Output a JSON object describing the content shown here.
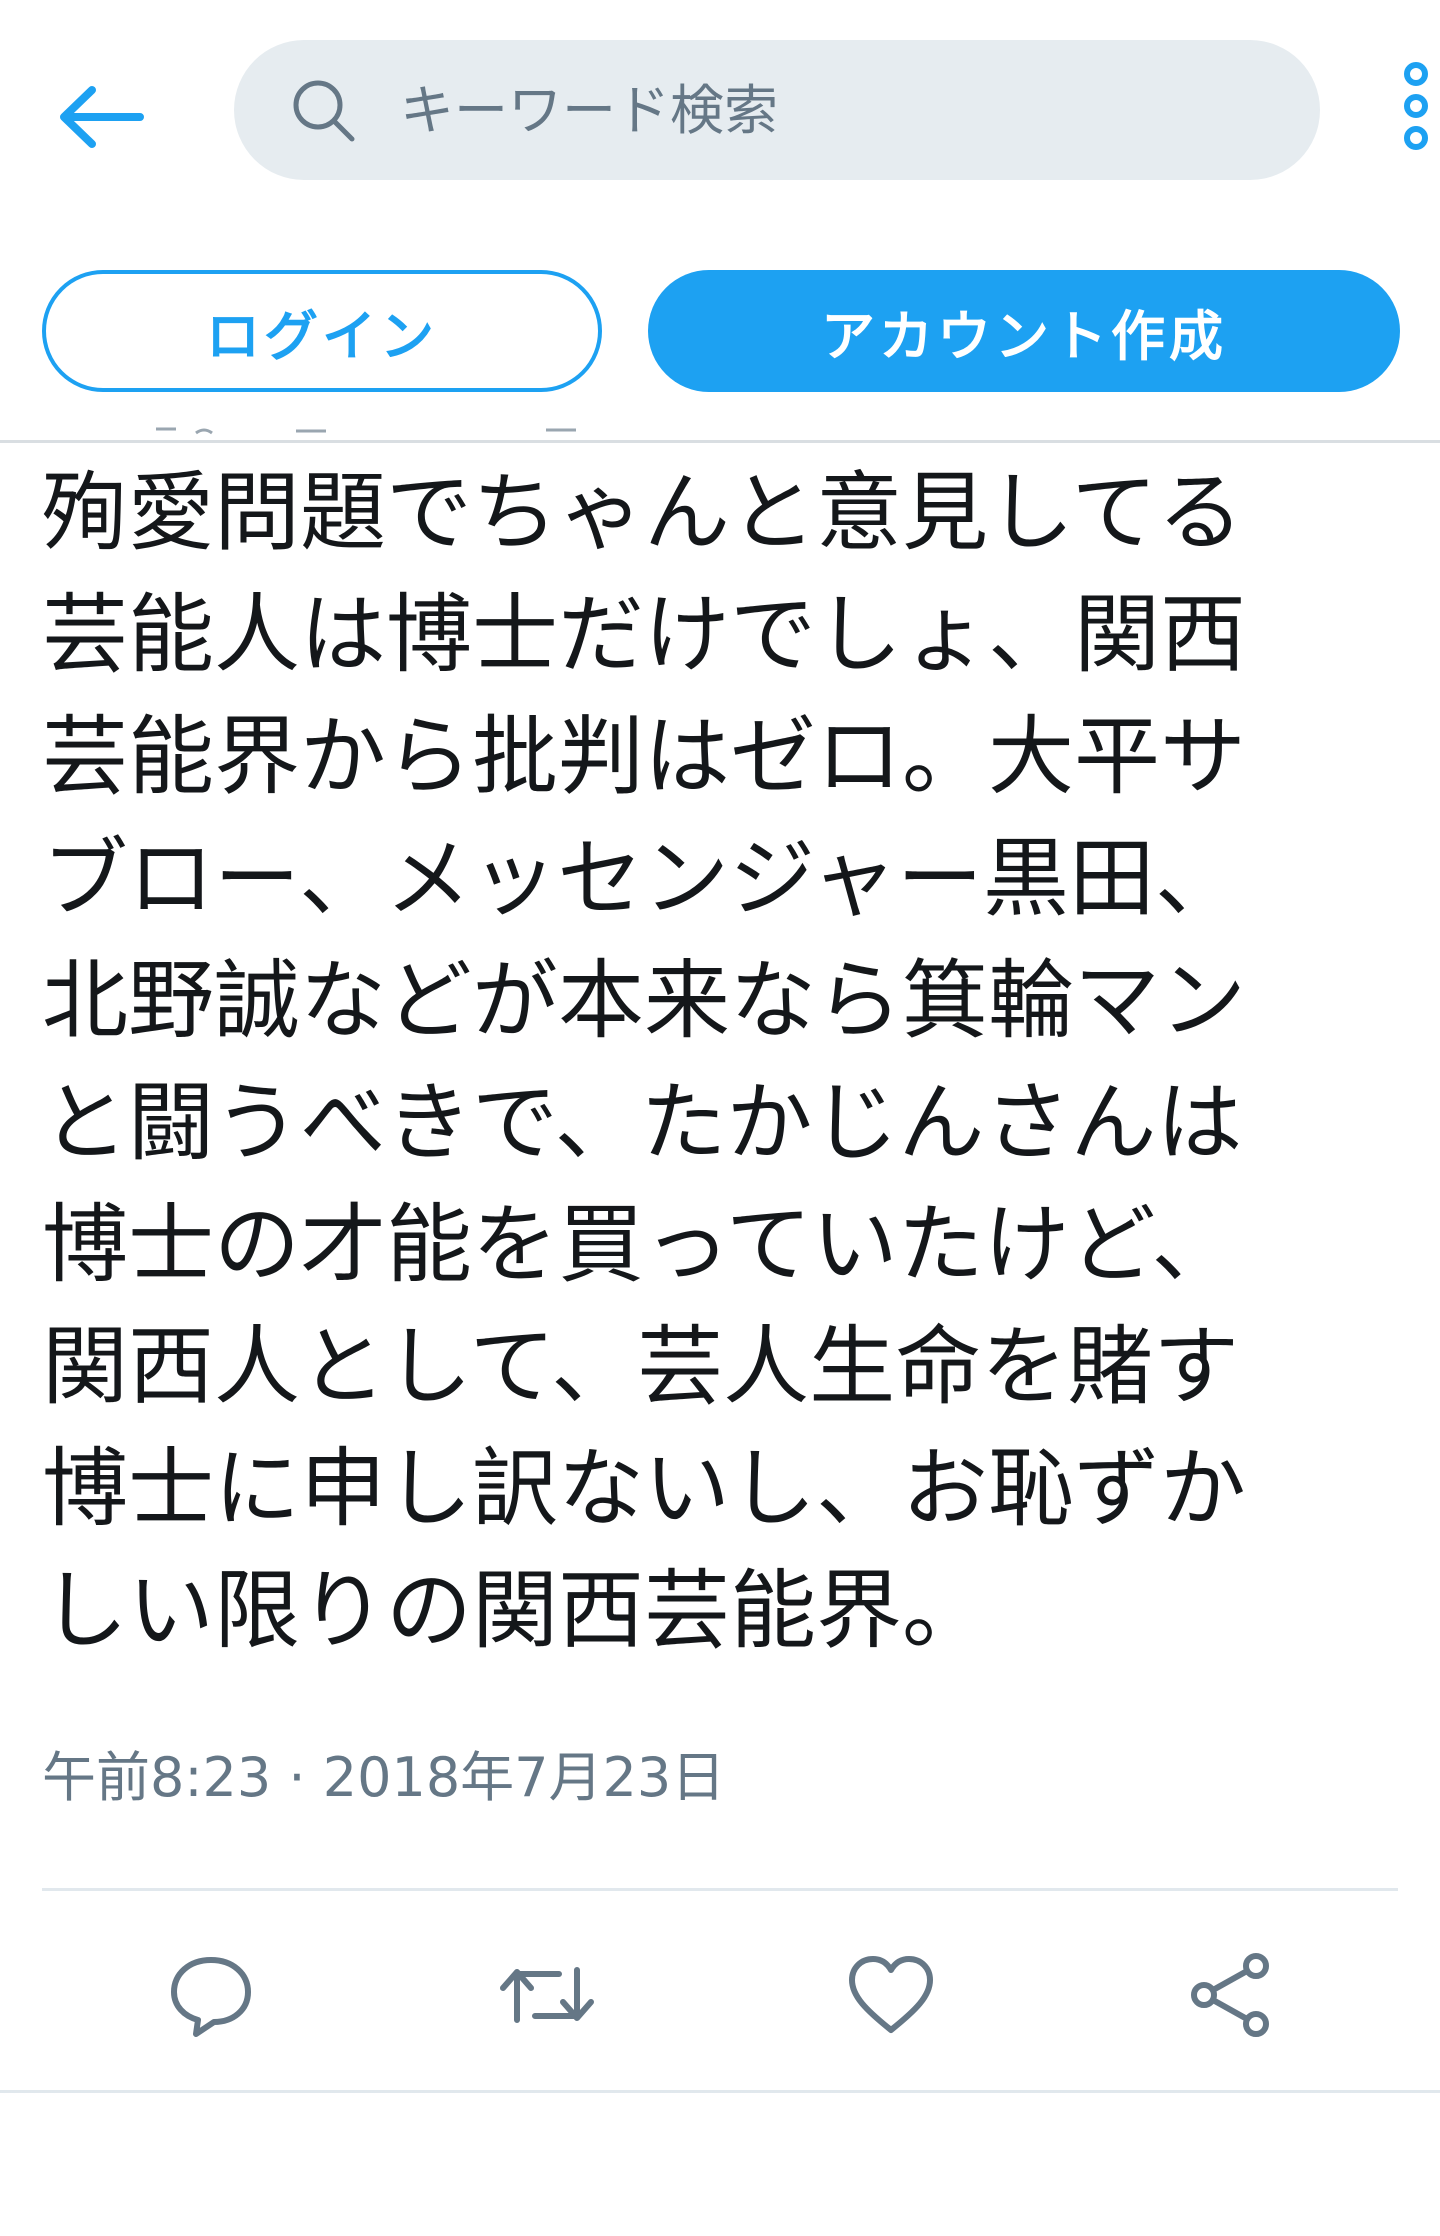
{
  "search": {
    "placeholder": "キーワード検索"
  },
  "auth": {
    "login_label": "ログイン",
    "signup_label": "アカウント作成"
  },
  "tweet": {
    "text": "殉愛問題でちゃんと意見してる\n芸能人は博士だけでしょ、関西\n芸能界から批判はゼロ。大平サ\nブロー、メッセンジャー黒田、\n北野誠などが本来なら箕輪マン\nと闘うべきで、たかじんさんは\n博士の才能を買っていたけど、\n関西人として、芸人生命を賭す\n博士に申し訳ないし、お恥ずか\nしい限りの関西芸能界。",
    "timestamp": "午前8:23 · 2018年7月23日"
  },
  "icons": {
    "back": "arrow-left-icon",
    "search": "search-icon",
    "more": "more-vertical-icon",
    "reply": "reply-icon",
    "retweet": "retweet-icon",
    "like": "heart-icon",
    "share": "share-icon"
  },
  "colors": {
    "accent": "#1da1f2",
    "text": "#14171a",
    "secondary_text": "#657786",
    "search_bg": "#e6ecf0",
    "action_icon": "#657786"
  }
}
